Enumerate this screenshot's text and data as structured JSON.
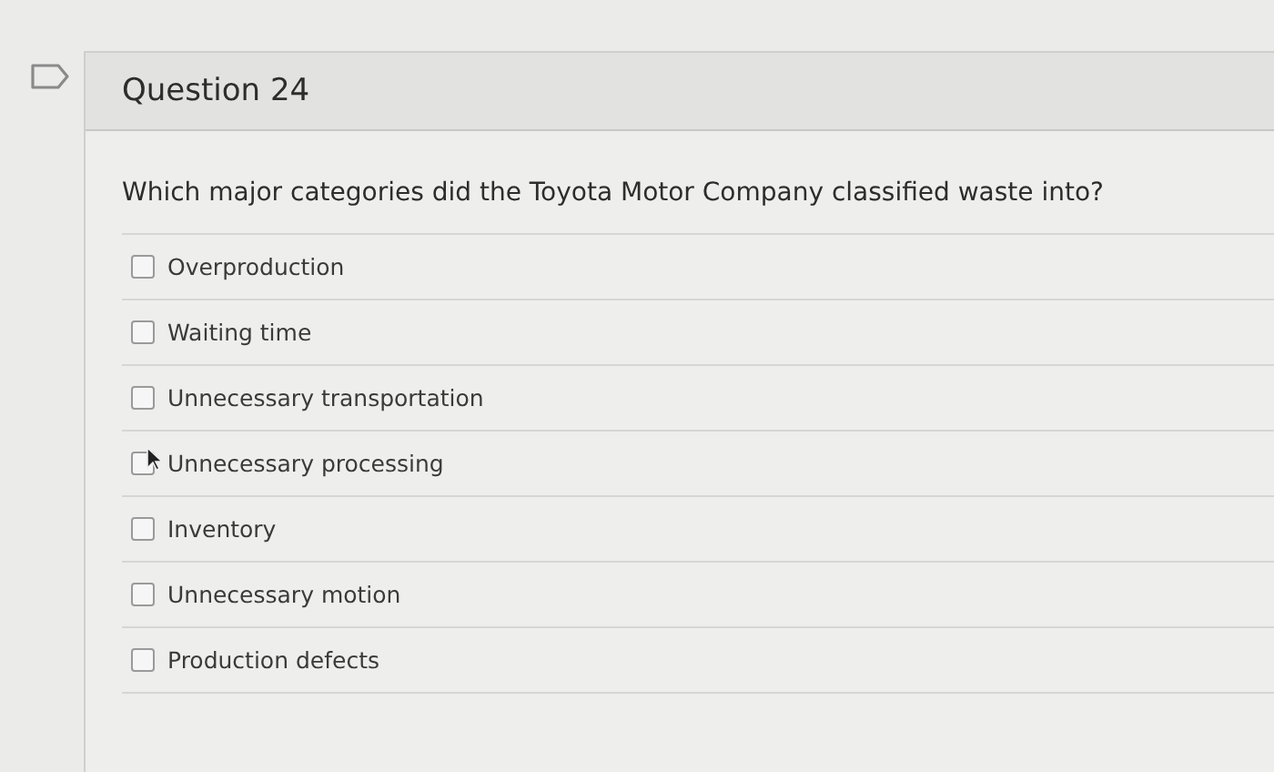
{
  "question": {
    "title": "Question 24",
    "text": "Which major categories did the Toyota Motor Company classified waste into?",
    "options": [
      {
        "label": "Overproduction",
        "checked": false
      },
      {
        "label": "Waiting time",
        "checked": false
      },
      {
        "label": "Unnecessary transportation",
        "checked": false
      },
      {
        "label": "Unnecessary processing",
        "checked": false
      },
      {
        "label": "Inventory",
        "checked": false
      },
      {
        "label": "Unnecessary motion",
        "checked": false
      },
      {
        "label": "Production defects",
        "checked": false
      }
    ]
  }
}
